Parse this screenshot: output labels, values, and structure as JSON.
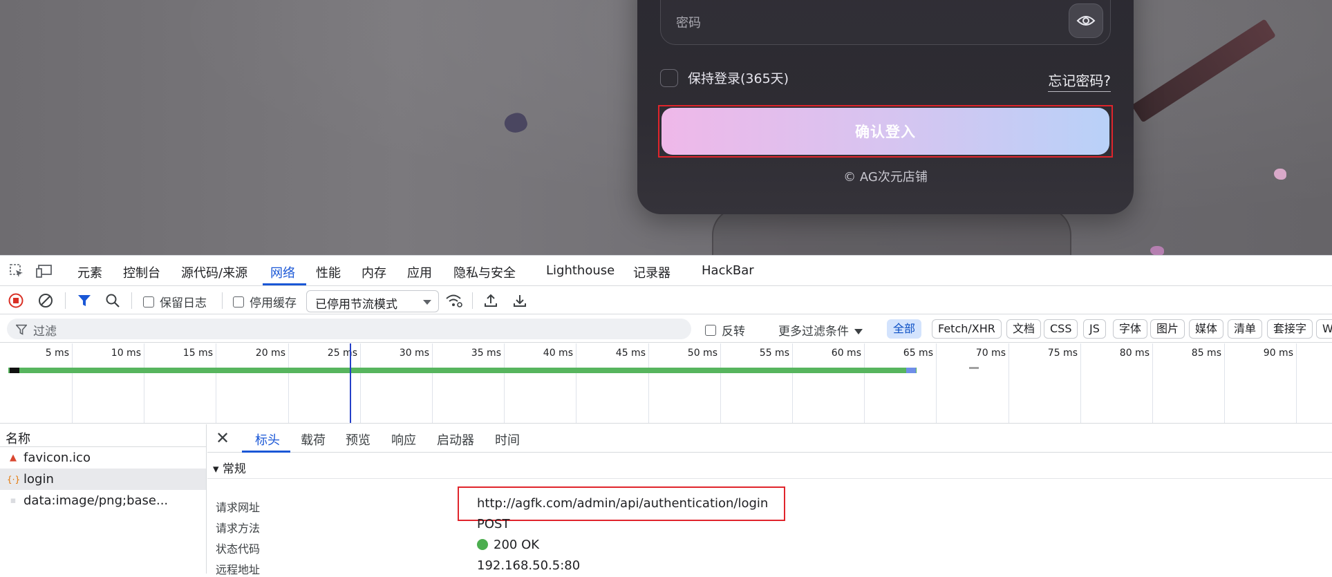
{
  "login_card": {
    "password_placeholder": "密码",
    "remember_label": "保持登录(365天)",
    "forgot_label": "忘记密码?",
    "login_button": "确认登入",
    "copyright": "© AG次元店铺"
  },
  "devtools": {
    "tabs": [
      "元素",
      "控制台",
      "源代码/来源",
      "网络",
      "性能",
      "内存",
      "应用",
      "隐私与安全",
      "Lighthouse",
      "记录器",
      "HackBar"
    ],
    "active_tab": "网络",
    "toolbar": {
      "preserve_log": "保留日志",
      "disable_cache": "停用缓存",
      "throttling": "已停用节流模式"
    },
    "filter": {
      "placeholder": "过滤",
      "invert": "反转",
      "more_filters": "更多过滤条件",
      "chips": [
        "全部",
        "Fetch/XHR",
        "文档",
        "CSS",
        "JS",
        "字体",
        "图片",
        "媒体",
        "清单",
        "套接字",
        "W"
      ],
      "active_chip": "全部"
    },
    "timeline": {
      "ticks": [
        "5 ms",
        "10 ms",
        "15 ms",
        "20 ms",
        "25 ms",
        "30 ms",
        "35 ms",
        "40 ms",
        "45 ms",
        "50 ms",
        "55 ms",
        "60 ms",
        "65 ms",
        "70 ms",
        "75 ms",
        "80 ms",
        "85 ms",
        "90 ms"
      ]
    },
    "requests": {
      "header": "名称",
      "items": [
        {
          "name": "favicon.ico",
          "icon": "image-icon"
        },
        {
          "name": "login",
          "icon": "fetch-icon"
        },
        {
          "name": "data:image/png;base...",
          "icon": "image-icon"
        }
      ],
      "selected": "login"
    },
    "details": {
      "tabs": [
        "标头",
        "载荷",
        "预览",
        "响应",
        "启动器",
        "时间"
      ],
      "active_tab": "标头",
      "section": "▾ 常规",
      "rows": [
        {
          "key": "请求网址",
          "value": "http://agfk.com/admin/api/authentication/login"
        },
        {
          "key": "请求方法",
          "value": "POST"
        },
        {
          "key": "状态代码",
          "value": "200 OK"
        },
        {
          "key": "远程地址",
          "value": "192.168.50.5:80"
        }
      ]
    }
  },
  "colors": {
    "accent": "#1a57d6",
    "highlight_box": "#e0242b",
    "status_ok": "#4cae4f"
  }
}
